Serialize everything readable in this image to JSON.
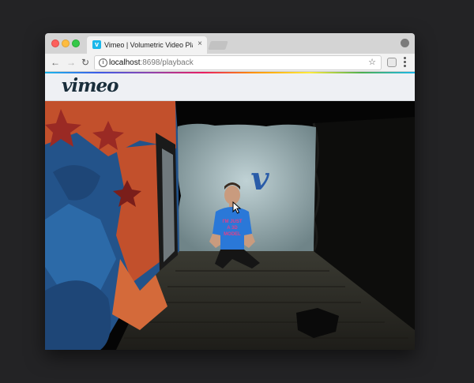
{
  "browser": {
    "tab": {
      "favicon": "v",
      "title": "Vimeo | Volumetric Video Playback",
      "close": "×"
    },
    "toolbar": {
      "back": "←",
      "forward": "→",
      "reload": "↻",
      "info_icon": "i",
      "url_host": "localhost",
      "url_rest": ":8698/playback",
      "star": "☆"
    }
  },
  "site": {
    "logo": "vimeo"
  },
  "scene": {
    "wall_logo": "v",
    "shirt_text": [
      "I'M JUST",
      "A 3D",
      "MODEL"
    ],
    "colors": {
      "back_wall": "#9fb3b8",
      "floor": "#2b2a24",
      "shirt": "#2a78d8",
      "shirt_text": "#e0408a",
      "logo_blue": "#2a5ca8"
    }
  }
}
